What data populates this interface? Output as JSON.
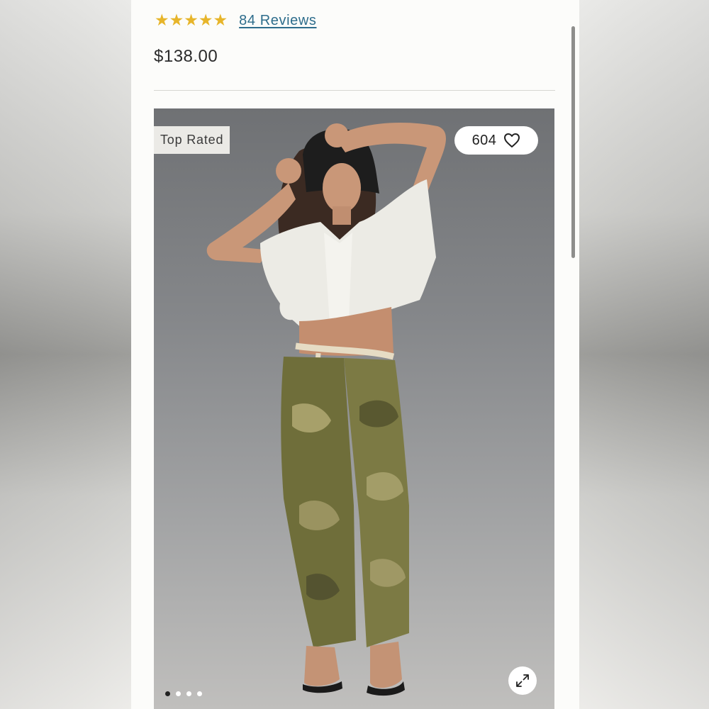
{
  "product": {
    "rating_stars": [
      "★",
      "★",
      "★",
      "★",
      "★"
    ],
    "reviews_link": "84 Reviews",
    "price": "$138.00"
  },
  "gallery": {
    "badge": "Top Rated",
    "like_count": "604",
    "image_alt": "Model wearing white eyelet cropped blouse, rope belt and camo barrel-leg cargo pants with black bucket hat",
    "slide_count": 4,
    "active_slide": 1
  },
  "colors": {
    "star": "#e7b52a",
    "link": "#2e6d8c",
    "text": "#2b2b2b"
  },
  "icons": {
    "like": "heart-icon",
    "expand": "expand-icon"
  }
}
